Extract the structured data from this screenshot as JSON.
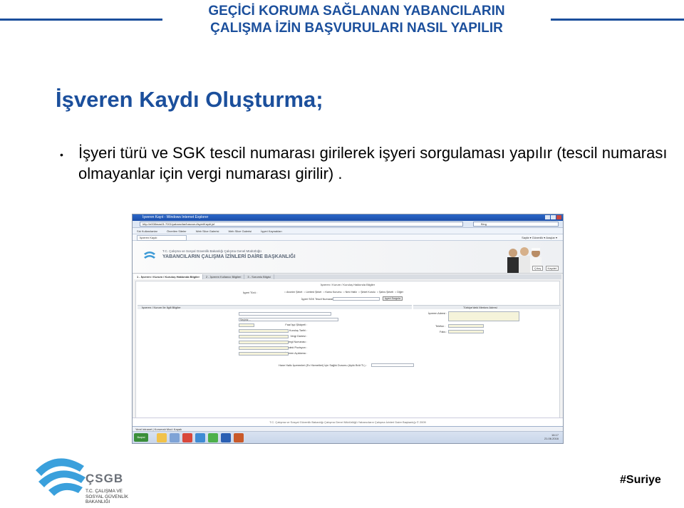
{
  "header": {
    "title_line1": "GEÇİCİ KORUMA SAĞLANAN YABANCILARIN",
    "title_line2": "ÇALIŞMA İZİN BAŞVURULARI NASIL YAPILIR",
    "accent_color": "#1b4f9c"
  },
  "section": {
    "title": "İşveren Kaydı Oluşturma;"
  },
  "bullets": [
    {
      "marker": "•",
      "text": "İşyeri türü ve SGK tescil numarası girilerek işyeri sorgulaması yapılır (tescil numarası olmayanlar için vergi numarası girilir) ."
    }
  ],
  "screenshot": {
    "window_title": "İşveren Kayıt - Windows Internet Explorer",
    "address": "http://e008mas01:7001/yabancilar/basvuru/isyeriKaydi.jsf",
    "search_placeholder": "Bing",
    "favorites": [
      "Sık Kullanılanlar",
      "Önerilen Siteler",
      "Web Slice Galerisi",
      "Web Slice Galerisi",
      "İşyeri Kaynakları"
    ],
    "tab_label": "İşveren Kaydı",
    "cmd_right": "Sayfa ▾  Güvenlik ▾  Araçlar ▾",
    "banner_line1": "T.C. Çalışma ve Sosyal Güvenlik Bakanlığı Çalışma Genel Müdürlüğü",
    "banner_line2": "YABANCILARIN ÇALIŞMA İZİNLERİ DAİRE BAŞKANLIĞI",
    "top_buttons": [
      "Çıkış",
      "Kaydet"
    ],
    "wizard_steps": [
      "1 - İşveren / Kurum / Kuruluş Hakkında Bilgiler",
      "2 - İşveren Kullanıcı Bilgileri",
      "3 - Sorumlu Bilgisi"
    ],
    "form_caption": "İşveren / Kurum / Kuruluş Hakkında Bilgiler",
    "workplace_type_label": "İşyeri Türü :",
    "workplace_types": [
      "Anonim Şirket",
      "Limited Şirket",
      "Kamu Kurumu",
      "Nevi Hafiz",
      "Şirket Kurulu",
      "Şahıs Şirketi",
      "Diğer"
    ],
    "sgk_label": "İşyeri SGK Tescil Numarası :",
    "sgk_button": "İşyeri Sorgula",
    "sub_left": "İşveren / Kurum İle İlgili Bilgiler",
    "sub_right": "Türkiye'deki Merkez Adresi",
    "left_labels": [
      "Adı Soyadı / Ünvanı :",
      "Sektör :",
      "Faal İşçi Şikâyeti :",
      "Kuruluş Tarihi :",
      "Vergi Dairesi :",
      "Vergi Numarası :",
      "İşyerindeki Pozisyon :",
      "İşveren Açıklama :"
    ],
    "sector_value": "Seçiniz...",
    "right_labels": [
      "İşveren Adresi :",
      "Telefon :",
      "Faks :"
    ],
    "bottom_label": "Hane Halkı İşverenleri (Ev Hizmetleri) İçin Sağlık Durumu (Aylık Brüt TL) :",
    "footer": "T.C. Çalışma ve Sosyal Güvenlik Bakanlığı Çalışma Genel Müdürlüğü Yabancıların Çalışma İzinleri Daire Başkanlığı © 2009",
    "taskbar_start": "Başlat",
    "status_text": "Yerel intranet | Korumalı Mod: Kapalı",
    "clock_time": "16:17",
    "clock_date": "21.06.2016"
  },
  "brand": {
    "name": "ÇSGB",
    "sub_lines": [
      "T.C. ÇALIŞMA VE",
      "SOSYAL GÜVENLİK",
      "BAKANLIĞI"
    ]
  },
  "hashtag": "#Suriye"
}
